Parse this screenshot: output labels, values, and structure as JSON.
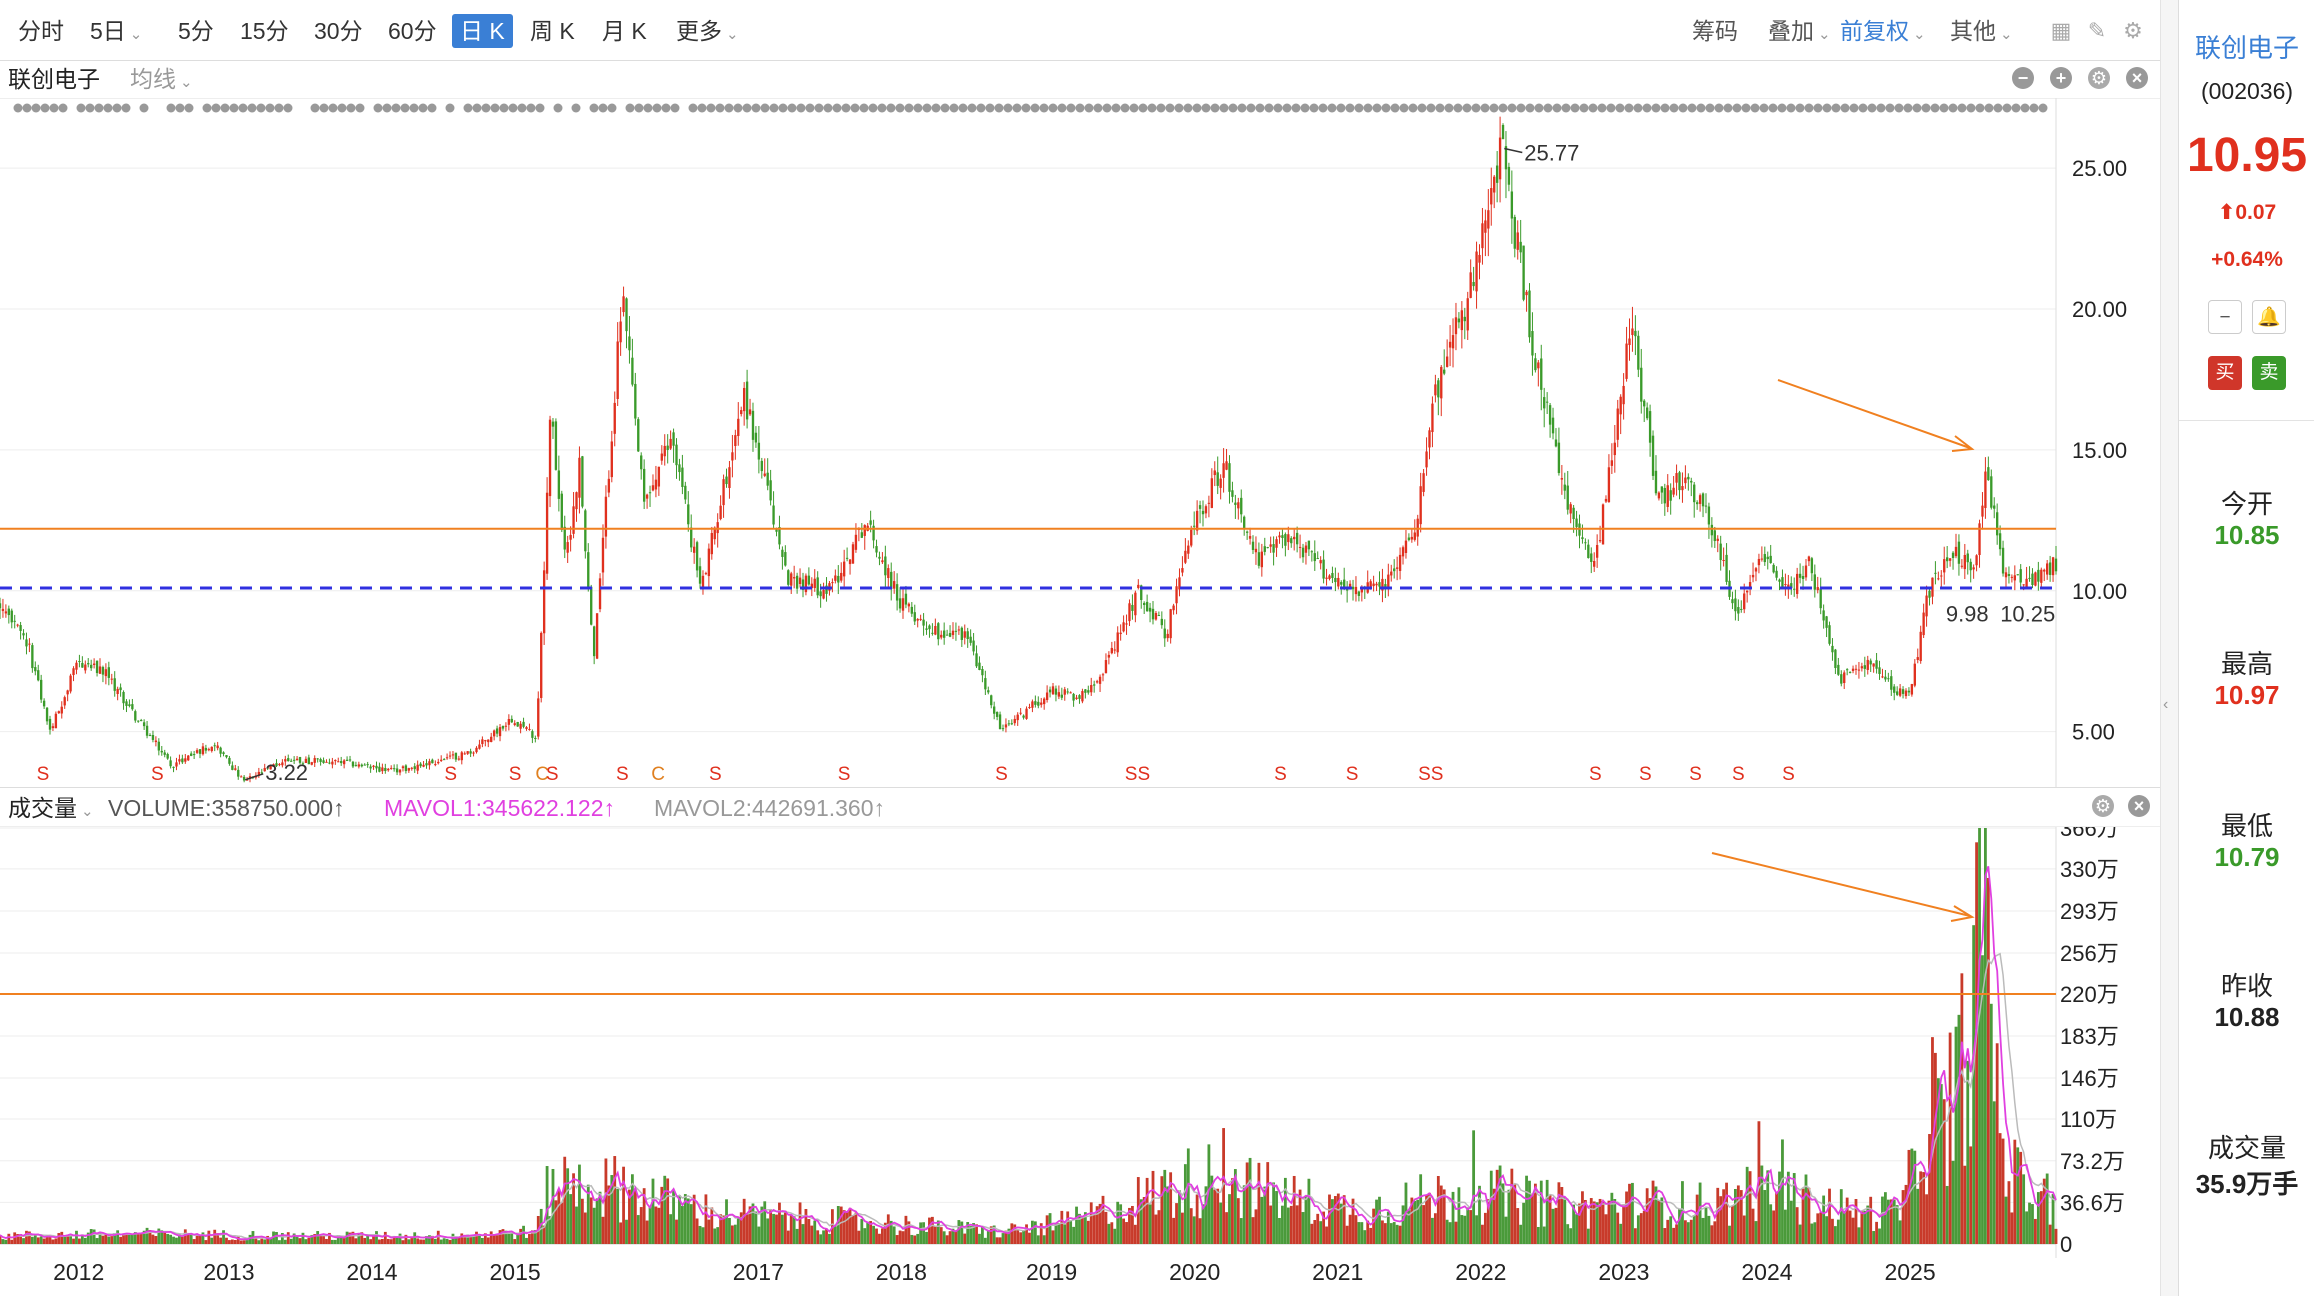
{
  "period_bar": {
    "tabs": [
      "分时",
      "5日",
      "5分",
      "15分",
      "30分",
      "60分",
      "日 K",
      "周 K",
      "月 K",
      "更多"
    ],
    "active_tab": "日 K",
    "right_tools": {
      "chips": "筹码",
      "overlay": "叠加",
      "adjust": "前复权",
      "other": "其他"
    }
  },
  "main_header": {
    "stock_name": "联创电子",
    "indicator": "均线"
  },
  "volume_header": {
    "label": "成交量",
    "volume": "VOLUME:358750.000↑",
    "mavol1": "MAVOL1:345622.122↑",
    "mavol2": "MAVOL2:442691.360↑"
  },
  "side_panel": {
    "name": "联创电子",
    "code": "(002036)",
    "price": "10.95",
    "change": "0.07",
    "change_pct": "+0.64%",
    "buy": "买",
    "sell": "卖",
    "open_label": "今开",
    "open": "10.85",
    "high_label": "最高",
    "high": "10.97",
    "low_label": "最低",
    "low": "10.79",
    "prev_label": "昨收",
    "prev": "10.88",
    "vol_label": "成交量",
    "vol": "35.9万手"
  },
  "colors": {
    "up": "#e0301e",
    "down": "#3a9a2a",
    "accent": "#3a7fd5",
    "mavol1": "#e040e0",
    "hline": "#f08020",
    "support": "#3030e0"
  },
  "chart_data": {
    "type": "candlestick",
    "title": "联创电子",
    "x_ticks": [
      "2012",
      "2013",
      "2014",
      "2015",
      "2017",
      "2018",
      "2019",
      "2020",
      "2021",
      "2022",
      "2023",
      "2024",
      "2025"
    ],
    "x_tick_years": [
      2011.55,
      2012.6,
      2013.6,
      2014.6,
      2016.3,
      2017.3,
      2018.35,
      2019.35,
      2020.35,
      2021.35,
      2022.35,
      2023.35,
      2024.35
    ],
    "price_axis": {
      "ticks": [
        "25.00",
        "20.00",
        "15.00",
        "10.00",
        "5.00"
      ],
      "tick_values": [
        25,
        20,
        15,
        10,
        5
      ],
      "range": [
        3.0,
        26.0
      ]
    },
    "volume_axis": {
      "ticks": [
        "366万",
        "330万",
        "293万",
        "256万",
        "220万",
        "183万",
        "146万",
        "110万",
        "73.2万",
        "36.6万",
        "0"
      ],
      "tick_values": [
        366,
        330,
        293,
        256,
        220,
        183,
        146,
        110,
        73.2,
        36.6,
        0
      ],
      "range": [
        0,
        366
      ]
    },
    "price_path": [
      [
        2011.0,
        9.5
      ],
      [
        2011.2,
        8.0
      ],
      [
        2011.35,
        5.0
      ],
      [
        2011.55,
        7.5
      ],
      [
        2011.75,
        7.0
      ],
      [
        2011.95,
        5.5
      ],
      [
        2012.2,
        3.8
      ],
      [
        2012.5,
        4.6
      ],
      [
        2012.7,
        3.22
      ],
      [
        2013.0,
        4.0
      ],
      [
        2013.4,
        3.9
      ],
      [
        2013.75,
        3.6
      ],
      [
        2014.1,
        4.0
      ],
      [
        2014.3,
        4.3
      ],
      [
        2014.58,
        5.5
      ],
      [
        2014.75,
        4.8
      ],
      [
        2014.85,
        16.5
      ],
      [
        2014.95,
        11.0
      ],
      [
        2015.05,
        14.5
      ],
      [
        2015.15,
        7.5
      ],
      [
        2015.35,
        20.5
      ],
      [
        2015.5,
        13.0
      ],
      [
        2015.7,
        15.5
      ],
      [
        2015.9,
        10.0
      ],
      [
        2016.2,
        17.0
      ],
      [
        2016.5,
        10.5
      ],
      [
        2016.8,
        10.0
      ],
      [
        2017.05,
        12.5
      ],
      [
        2017.3,
        9.5
      ],
      [
        2017.55,
        8.5
      ],
      [
        2017.75,
        8.5
      ],
      [
        2018.0,
        5.0
      ],
      [
        2018.35,
        6.5
      ],
      [
        2018.55,
        6.2
      ],
      [
        2018.75,
        7.5
      ],
      [
        2018.95,
        10.0
      ],
      [
        2019.15,
        8.5
      ],
      [
        2019.35,
        12.5
      ],
      [
        2019.55,
        14.5
      ],
      [
        2019.8,
        11.0
      ],
      [
        2020.0,
        12.0
      ],
      [
        2020.3,
        10.5
      ],
      [
        2020.5,
        10.0
      ],
      [
        2020.7,
        10.3
      ],
      [
        2020.9,
        12.5
      ],
      [
        2021.0,
        16.5
      ],
      [
        2021.3,
        21.0
      ],
      [
        2021.5,
        25.77
      ],
      [
        2021.7,
        19.0
      ],
      [
        2021.95,
        13.0
      ],
      [
        2022.15,
        11.0
      ],
      [
        2022.4,
        19.5
      ],
      [
        2022.6,
        13.0
      ],
      [
        2022.75,
        14.0
      ],
      [
        2022.95,
        12.5
      ],
      [
        2023.15,
        9.0
      ],
      [
        2023.3,
        11.5
      ],
      [
        2023.5,
        10.0
      ],
      [
        2023.65,
        11.0
      ],
      [
        2023.85,
        6.8
      ],
      [
        2024.05,
        7.5
      ],
      [
        2024.25,
        6.5
      ],
      [
        2024.35,
        6.3
      ],
      [
        2024.48,
        10.0
      ],
      [
        2024.65,
        11.5
      ],
      [
        2024.8,
        10.5
      ],
      [
        2024.88,
        14.5
      ],
      [
        2025.0,
        10.5
      ],
      [
        2025.2,
        10.5
      ],
      [
        2025.35,
        10.95
      ]
    ],
    "volume_path": [
      [
        2011.0,
        8
      ],
      [
        2012.0,
        10
      ],
      [
        2013.0,
        8
      ],
      [
        2014.0,
        8
      ],
      [
        2014.75,
        12
      ],
      [
        2014.85,
        60
      ],
      [
        2015.3,
        55
      ],
      [
        2016.0,
        30
      ],
      [
        2017.0,
        22
      ],
      [
        2018.0,
        12
      ],
      [
        2018.5,
        22
      ],
      [
        2019.0,
        45
      ],
      [
        2019.3,
        60
      ],
      [
        2019.5,
        65
      ],
      [
        2020.0,
        45
      ],
      [
        2020.5,
        32
      ],
      [
        2021.0,
        45
      ],
      [
        2021.5,
        48
      ],
      [
        2022.0,
        35
      ],
      [
        2022.5,
        40
      ],
      [
        2023.0,
        38
      ],
      [
        2023.3,
        55
      ],
      [
        2024.0,
        30
      ],
      [
        2024.3,
        35
      ],
      [
        2024.5,
        140
      ],
      [
        2024.62,
        90
      ],
      [
        2024.88,
        330
      ],
      [
        2025.0,
        80
      ],
      [
        2025.2,
        45
      ],
      [
        2025.35,
        36
      ]
    ],
    "volume_spikes": [
      [
        2014.87,
        66
      ],
      [
        2015.35,
        68
      ],
      [
        2019.55,
        102
      ],
      [
        2021.3,
        100
      ],
      [
        2023.3,
        108
      ],
      [
        2023.45,
        92
      ],
      [
        2024.5,
        182
      ],
      [
        2024.63,
        186
      ],
      [
        2024.88,
        366
      ],
      [
        2025.1,
        85
      ],
      [
        2025.3,
        62
      ]
    ],
    "horizontal_line_price": 12.2,
    "support_line_price": 10.1,
    "horizontal_line_volume": 220,
    "annotations": [
      {
        "text": "25.77",
        "year": 2021.5,
        "price": 25.77
      },
      {
        "text": "3.22",
        "year": 2012.7,
        "price": 3.22
      },
      {
        "text": "9.98",
        "year": 2024.6,
        "price": 9.2
      },
      {
        "text": "10.25",
        "year": 2024.98,
        "price": 9.2
      }
    ],
    "signal_markers": [
      {
        "label": "S",
        "year": 2011.3
      },
      {
        "label": "S",
        "year": 2012.1
      },
      {
        "label": "S",
        "year": 2014.15
      },
      {
        "label": "S",
        "year": 2014.6
      },
      {
        "label": "C",
        "year": 2014.79
      },
      {
        "label": "S",
        "year": 2014.86
      },
      {
        "label": "S",
        "year": 2015.35
      },
      {
        "label": "C",
        "year": 2015.6
      },
      {
        "label": "S",
        "year": 2016.0
      },
      {
        "label": "S",
        "year": 2016.9
      },
      {
        "label": "S",
        "year": 2018.0
      },
      {
        "label": "SS",
        "year": 2018.95
      },
      {
        "label": "S",
        "year": 2019.95
      },
      {
        "label": "S",
        "year": 2020.45
      },
      {
        "label": "SS",
        "year": 2021.0
      },
      {
        "label": "S",
        "year": 2022.15
      },
      {
        "label": "S",
        "year": 2022.5
      },
      {
        "label": "S",
        "year": 2022.85
      },
      {
        "label": "S",
        "year": 2023.15
      },
      {
        "label": "S",
        "year": 2023.5
      }
    ]
  }
}
